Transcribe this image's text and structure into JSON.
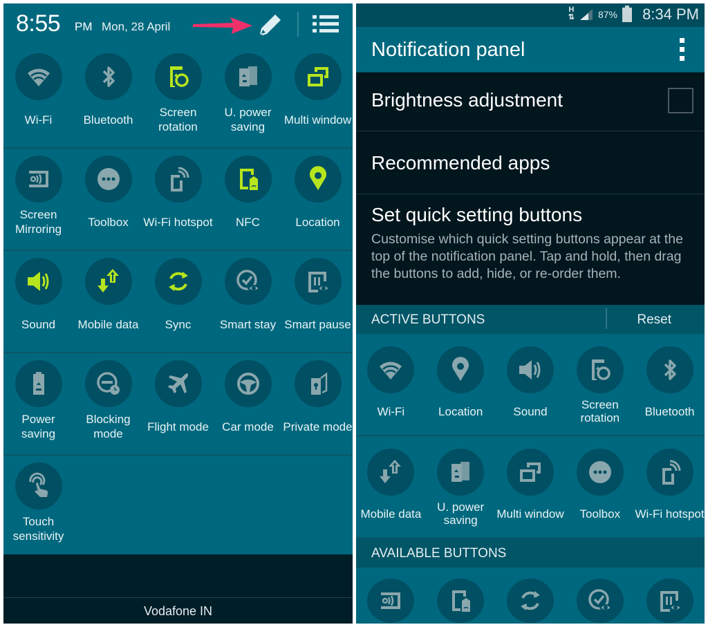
{
  "left_panel": {
    "time": "8:55",
    "ampm": "PM",
    "date": "Mon, 28 April",
    "edit_icon": "pencil-icon",
    "list_icon": "list-icon",
    "annotation_arrow_color": "#f0306a",
    "active_color": "#b6e51d",
    "inactive_color": "#8aa7ad",
    "tiles": [
      {
        "label": "Wi-Fi",
        "icon": "wifi",
        "active": false
      },
      {
        "label": "Bluetooth",
        "icon": "bluetooth",
        "active": false
      },
      {
        "label": "Screen rotation",
        "icon": "rotation",
        "active": true
      },
      {
        "label": "U. power saving",
        "icon": "upower",
        "active": false
      },
      {
        "label": "Multi window",
        "icon": "multiwindow",
        "active": true
      },
      {
        "label": "Screen Mirroring",
        "icon": "mirroring",
        "active": false
      },
      {
        "label": "Toolbox",
        "icon": "toolbox",
        "active": false
      },
      {
        "label": "Wi-Fi hotspot",
        "icon": "hotspot",
        "active": false
      },
      {
        "label": "NFC",
        "icon": "nfc",
        "active": true
      },
      {
        "label": "Location",
        "icon": "location",
        "active": true
      },
      {
        "label": "Sound",
        "icon": "sound",
        "active": true
      },
      {
        "label": "Mobile data",
        "icon": "mobiledata",
        "active": true
      },
      {
        "label": "Sync",
        "icon": "sync",
        "active": true
      },
      {
        "label": "Smart stay",
        "icon": "smartstay",
        "active": false
      },
      {
        "label": "Smart pause",
        "icon": "smartpause",
        "active": false
      },
      {
        "label": "Power saving",
        "icon": "powersaving",
        "active": false
      },
      {
        "label": "Blocking mode",
        "icon": "blocking",
        "active": false
      },
      {
        "label": "Flight mode",
        "icon": "flight",
        "active": false
      },
      {
        "label": "Car mode",
        "icon": "car",
        "active": false
      },
      {
        "label": "Private mode",
        "icon": "private",
        "active": false
      },
      {
        "label": "Touch sensitivity",
        "icon": "touch",
        "active": false
      }
    ],
    "carrier": "Vodafone IN"
  },
  "right_panel": {
    "status_bar": {
      "network": "H",
      "signal_icon": "signal-icon",
      "battery_percent": "87%",
      "battery_icon": "battery-icon",
      "time": "8:34 PM"
    },
    "title": "Notification panel",
    "menu_icon": "more-vert-icon",
    "settings": {
      "brightness": {
        "label": "Brightness adjustment",
        "checked": false
      },
      "recommended": {
        "label": "Recommended apps"
      },
      "quick": {
        "label": "Set quick setting buttons",
        "description": "Customise which quick setting buttons appear at the top of the notification panel. Tap and hold, then drag the buttons to add, hide, or re-order them."
      }
    },
    "active_header": "ACTIVE BUTTONS",
    "reset_label": "Reset",
    "active_buttons": [
      {
        "label": "Wi-Fi",
        "icon": "wifi"
      },
      {
        "label": "Location",
        "icon": "location"
      },
      {
        "label": "Sound",
        "icon": "sound"
      },
      {
        "label": "Screen rotation",
        "icon": "rotation"
      },
      {
        "label": "Bluetooth",
        "icon": "bluetooth"
      },
      {
        "label": "Mobile data",
        "icon": "mobiledata"
      },
      {
        "label": "U. power saving",
        "icon": "upower"
      },
      {
        "label": "Multi window",
        "icon": "multiwindow"
      },
      {
        "label": "Toolbox",
        "icon": "toolbox"
      },
      {
        "label": "Wi-Fi hotspot",
        "icon": "hotspot"
      }
    ],
    "available_header": "AVAILABLE BUTTONS",
    "available_buttons": [
      {
        "icon": "mirroring"
      },
      {
        "icon": "nfc"
      },
      {
        "icon": "sync"
      },
      {
        "icon": "smartstay"
      },
      {
        "icon": "smartpause"
      }
    ]
  }
}
